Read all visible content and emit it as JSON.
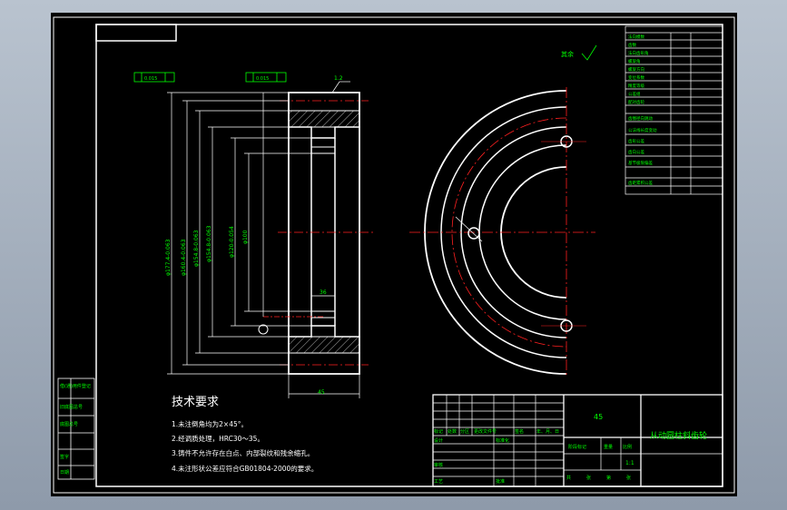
{
  "tech_req": {
    "title": "技术要求",
    "items": [
      "1.未注倒角均为2×45°。",
      "2.经调质处理，HRC30～35。",
      "3.铸件不允许存在白点、内部裂纹和残余缩孔。",
      "4.未注形状公差应符合GB01804-2000的要求。"
    ]
  },
  "dims": {
    "d1": "φ177.4-0.063",
    "d2": "φ160.4-0.063",
    "d3": "φ154.8-0.063",
    "d4": "φ120-0.054",
    "d5": "φ100",
    "width": "45",
    "hub": "36",
    "chamfer": "1.2",
    "tol1": "0.015",
    "tol2": "0.015",
    "finish": "其余"
  },
  "params": {
    "rows": [
      "法向模数",
      "齿数",
      "法向齿形角",
      "螺旋角",
      "螺旋方向",
      "变位系数",
      "精度等级",
      "公差组",
      "配对齿轮",
      "齿圈径向跳动",
      "公法线长度变动",
      "齿形公差",
      "齿向公差",
      "基节极限偏差",
      "齿距累积公差"
    ]
  },
  "title_block": {
    "material": "45",
    "part_name": "从动圆柱斜齿轮",
    "scale": "1:1",
    "labels": [
      "标记",
      "处数",
      "分区",
      "更改文件号",
      "签名",
      "年、月、日",
      "设计",
      "标准化",
      "审核",
      "工艺",
      "批准",
      "阶段标记",
      "重量",
      "比例",
      "共",
      "张",
      "第",
      "张"
    ]
  },
  "side_table": {
    "rows": [
      "借(通)用件登记",
      "旧底图总号",
      "底图总号",
      "签字",
      "日期"
    ]
  }
}
